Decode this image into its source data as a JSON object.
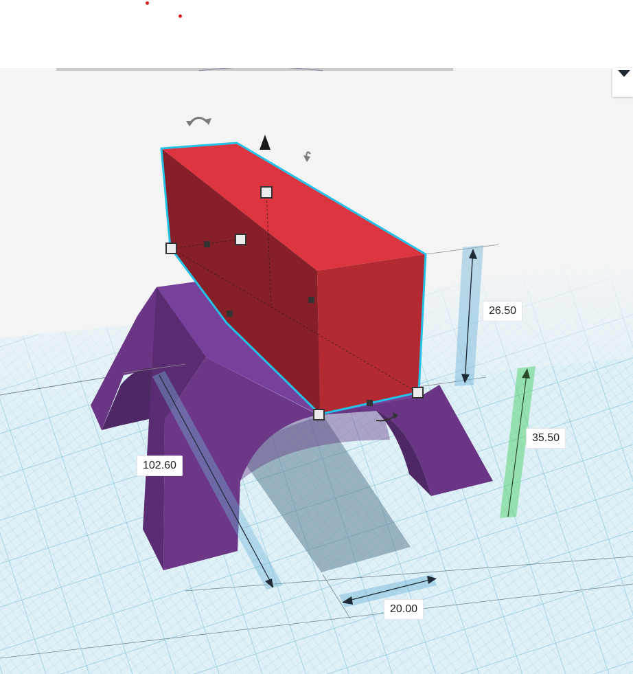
{
  "dimensions": {
    "height_top": "26.50",
    "elevation": "35.50",
    "length": "102.60",
    "width": "20.00"
  },
  "colors": {
    "box_top": "#dd3540",
    "box_front": "#b42a32",
    "box_side": "#861f27",
    "support": "#6b3585",
    "support_dark": "#4e2864",
    "selection": "#25c2e8",
    "grid_bg": "#d8eef6",
    "grid_line": "#9dd3e7"
  },
  "icons": {
    "rotate_top": "rotate-arrow-icon",
    "rotate_side": "rotate-arrow-icon",
    "move_up": "move-up-cone-icon",
    "view_menu": "chevron-down-icon"
  }
}
